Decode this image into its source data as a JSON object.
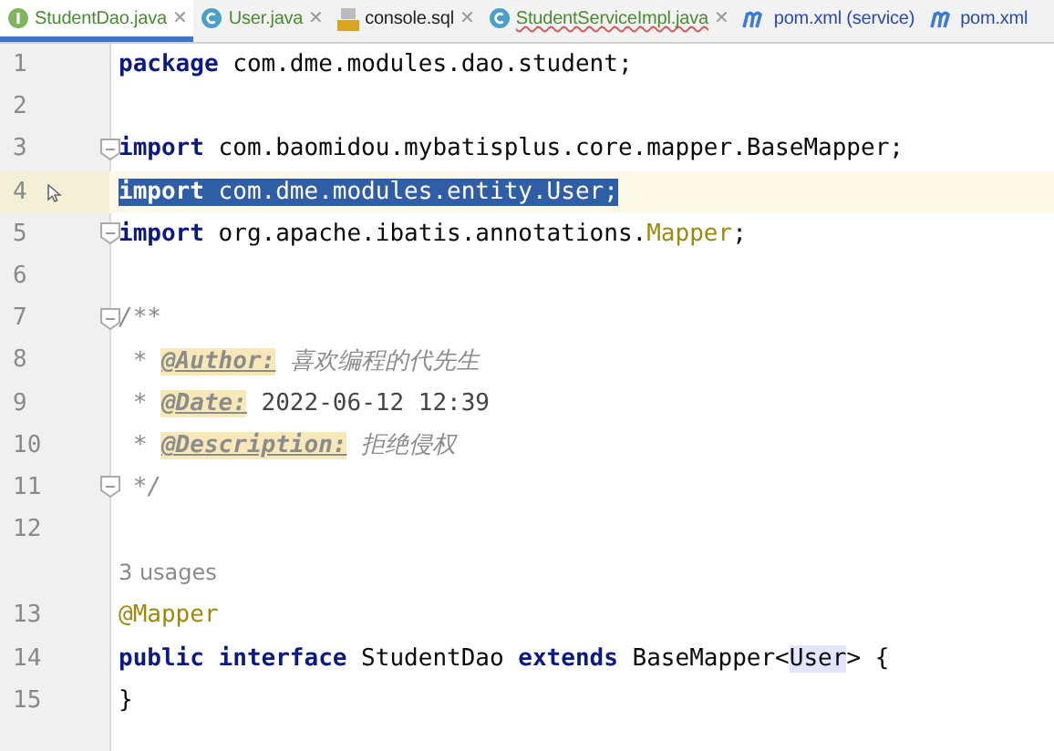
{
  "tabs": [
    {
      "label": "StudentDao.java",
      "kind": "interface",
      "color": "#4a8a32",
      "selected": true,
      "error": false,
      "close": "✕"
    },
    {
      "label": "User.java",
      "kind": "class",
      "color": "#4a8a32",
      "selected": false,
      "error": false,
      "close": "✕"
    },
    {
      "label": "console.sql",
      "kind": "sql",
      "color": "#1e1e1e",
      "selected": false,
      "error": false,
      "close": "✕"
    },
    {
      "label": "StudentServiceImpl.java",
      "kind": "class",
      "color": "#4a8a32",
      "selected": false,
      "error": true,
      "close": "✕"
    },
    {
      "label": "pom.xml (service)",
      "kind": "maven",
      "color": "#2a4aa8",
      "selected": false,
      "error": false
    },
    {
      "label": "pom.xml",
      "kind": "maven",
      "color": "#2a4aa8",
      "selected": false,
      "error": false
    }
  ],
  "lines": [
    {
      "number": "1",
      "selected": false,
      "fold": false,
      "tokens": [
        {
          "kind": "keyword",
          "text": "package"
        },
        {
          "kind": "plain",
          "text": " com.dme.modules.dao.student;"
        }
      ]
    },
    {
      "number": "2",
      "selected": false,
      "fold": false
    },
    {
      "number": "3",
      "selected": false,
      "fold": true,
      "tokens": [
        {
          "kind": "keyword",
          "text": "import"
        },
        {
          "kind": "plain",
          "text": " com.baomidou.mybatisplus.core.mapper.BaseMapper;"
        }
      ]
    },
    {
      "number": "4",
      "selected": true,
      "fold": false,
      "pointer": true,
      "tokens": [
        {
          "kind": "keyword",
          "text": "import"
        },
        {
          "kind": "plain",
          "text": " com.dme.modules.entity.User;"
        }
      ]
    },
    {
      "number": "5",
      "selected": false,
      "fold": true,
      "tokens": [
        {
          "kind": "keyword",
          "text": "import"
        },
        {
          "kind": "plain",
          "text": " org.apache.ibatis.annotations."
        },
        {
          "kind": "annotation",
          "text": "Mapper"
        },
        {
          "kind": "plain",
          "text": ";"
        }
      ]
    },
    {
      "number": "6",
      "selected": false,
      "fold": false
    },
    {
      "number": "7",
      "selected": false,
      "fold": true,
      "tokens": [
        {
          "kind": "comment",
          "text": "/**"
        }
      ]
    },
    {
      "number": "8",
      "selected": false,
      "fold": false,
      "tokens": [
        {
          "kind": "comment",
          "text": " * "
        },
        {
          "kind": "doctag",
          "text": "@Author:"
        },
        {
          "kind": "comment",
          "text": " 喜欢编程的代先生"
        }
      ]
    },
    {
      "number": "9",
      "selected": false,
      "fold": false,
      "tokens": [
        {
          "kind": "comment",
          "text": " * "
        },
        {
          "kind": "doctag",
          "text": "@Date:"
        },
        {
          "kind": "docvalue",
          "text": " 2022-06-12 12:39"
        }
      ]
    },
    {
      "number": "10",
      "selected": false,
      "fold": false,
      "tokens": [
        {
          "kind": "comment",
          "text": " * "
        },
        {
          "kind": "doctag",
          "text": "@Description:"
        },
        {
          "kind": "comment",
          "text": " 拒绝侵权"
        }
      ]
    },
    {
      "number": "11",
      "selected": false,
      "fold": true,
      "tokens": [
        {
          "kind": "comment",
          "text": " */"
        }
      ]
    },
    {
      "number": "12",
      "selected": false,
      "fold": false
    },
    {
      "number": "13",
      "selected": false,
      "fold": false,
      "hint": "3 usages",
      "tokens": [
        {
          "kind": "annotation",
          "text": "@Mapper"
        }
      ]
    },
    {
      "number": "14",
      "selected": false,
      "fold": false,
      "tokens": [
        {
          "kind": "keyword",
          "text": "public interface"
        },
        {
          "kind": "plain",
          "text": " StudentDao "
        },
        {
          "kind": "keyword",
          "text": "extends"
        },
        {
          "kind": "plain",
          "text": " BaseMapper<"
        },
        {
          "kind": "highlight",
          "text": "User"
        },
        {
          "kind": "plain",
          "text": "> {"
        }
      ]
    },
    {
      "number": "15",
      "selected": false,
      "fold": false,
      "tokens": [
        {
          "kind": "plain",
          "text": "}"
        }
      ]
    }
  ]
}
